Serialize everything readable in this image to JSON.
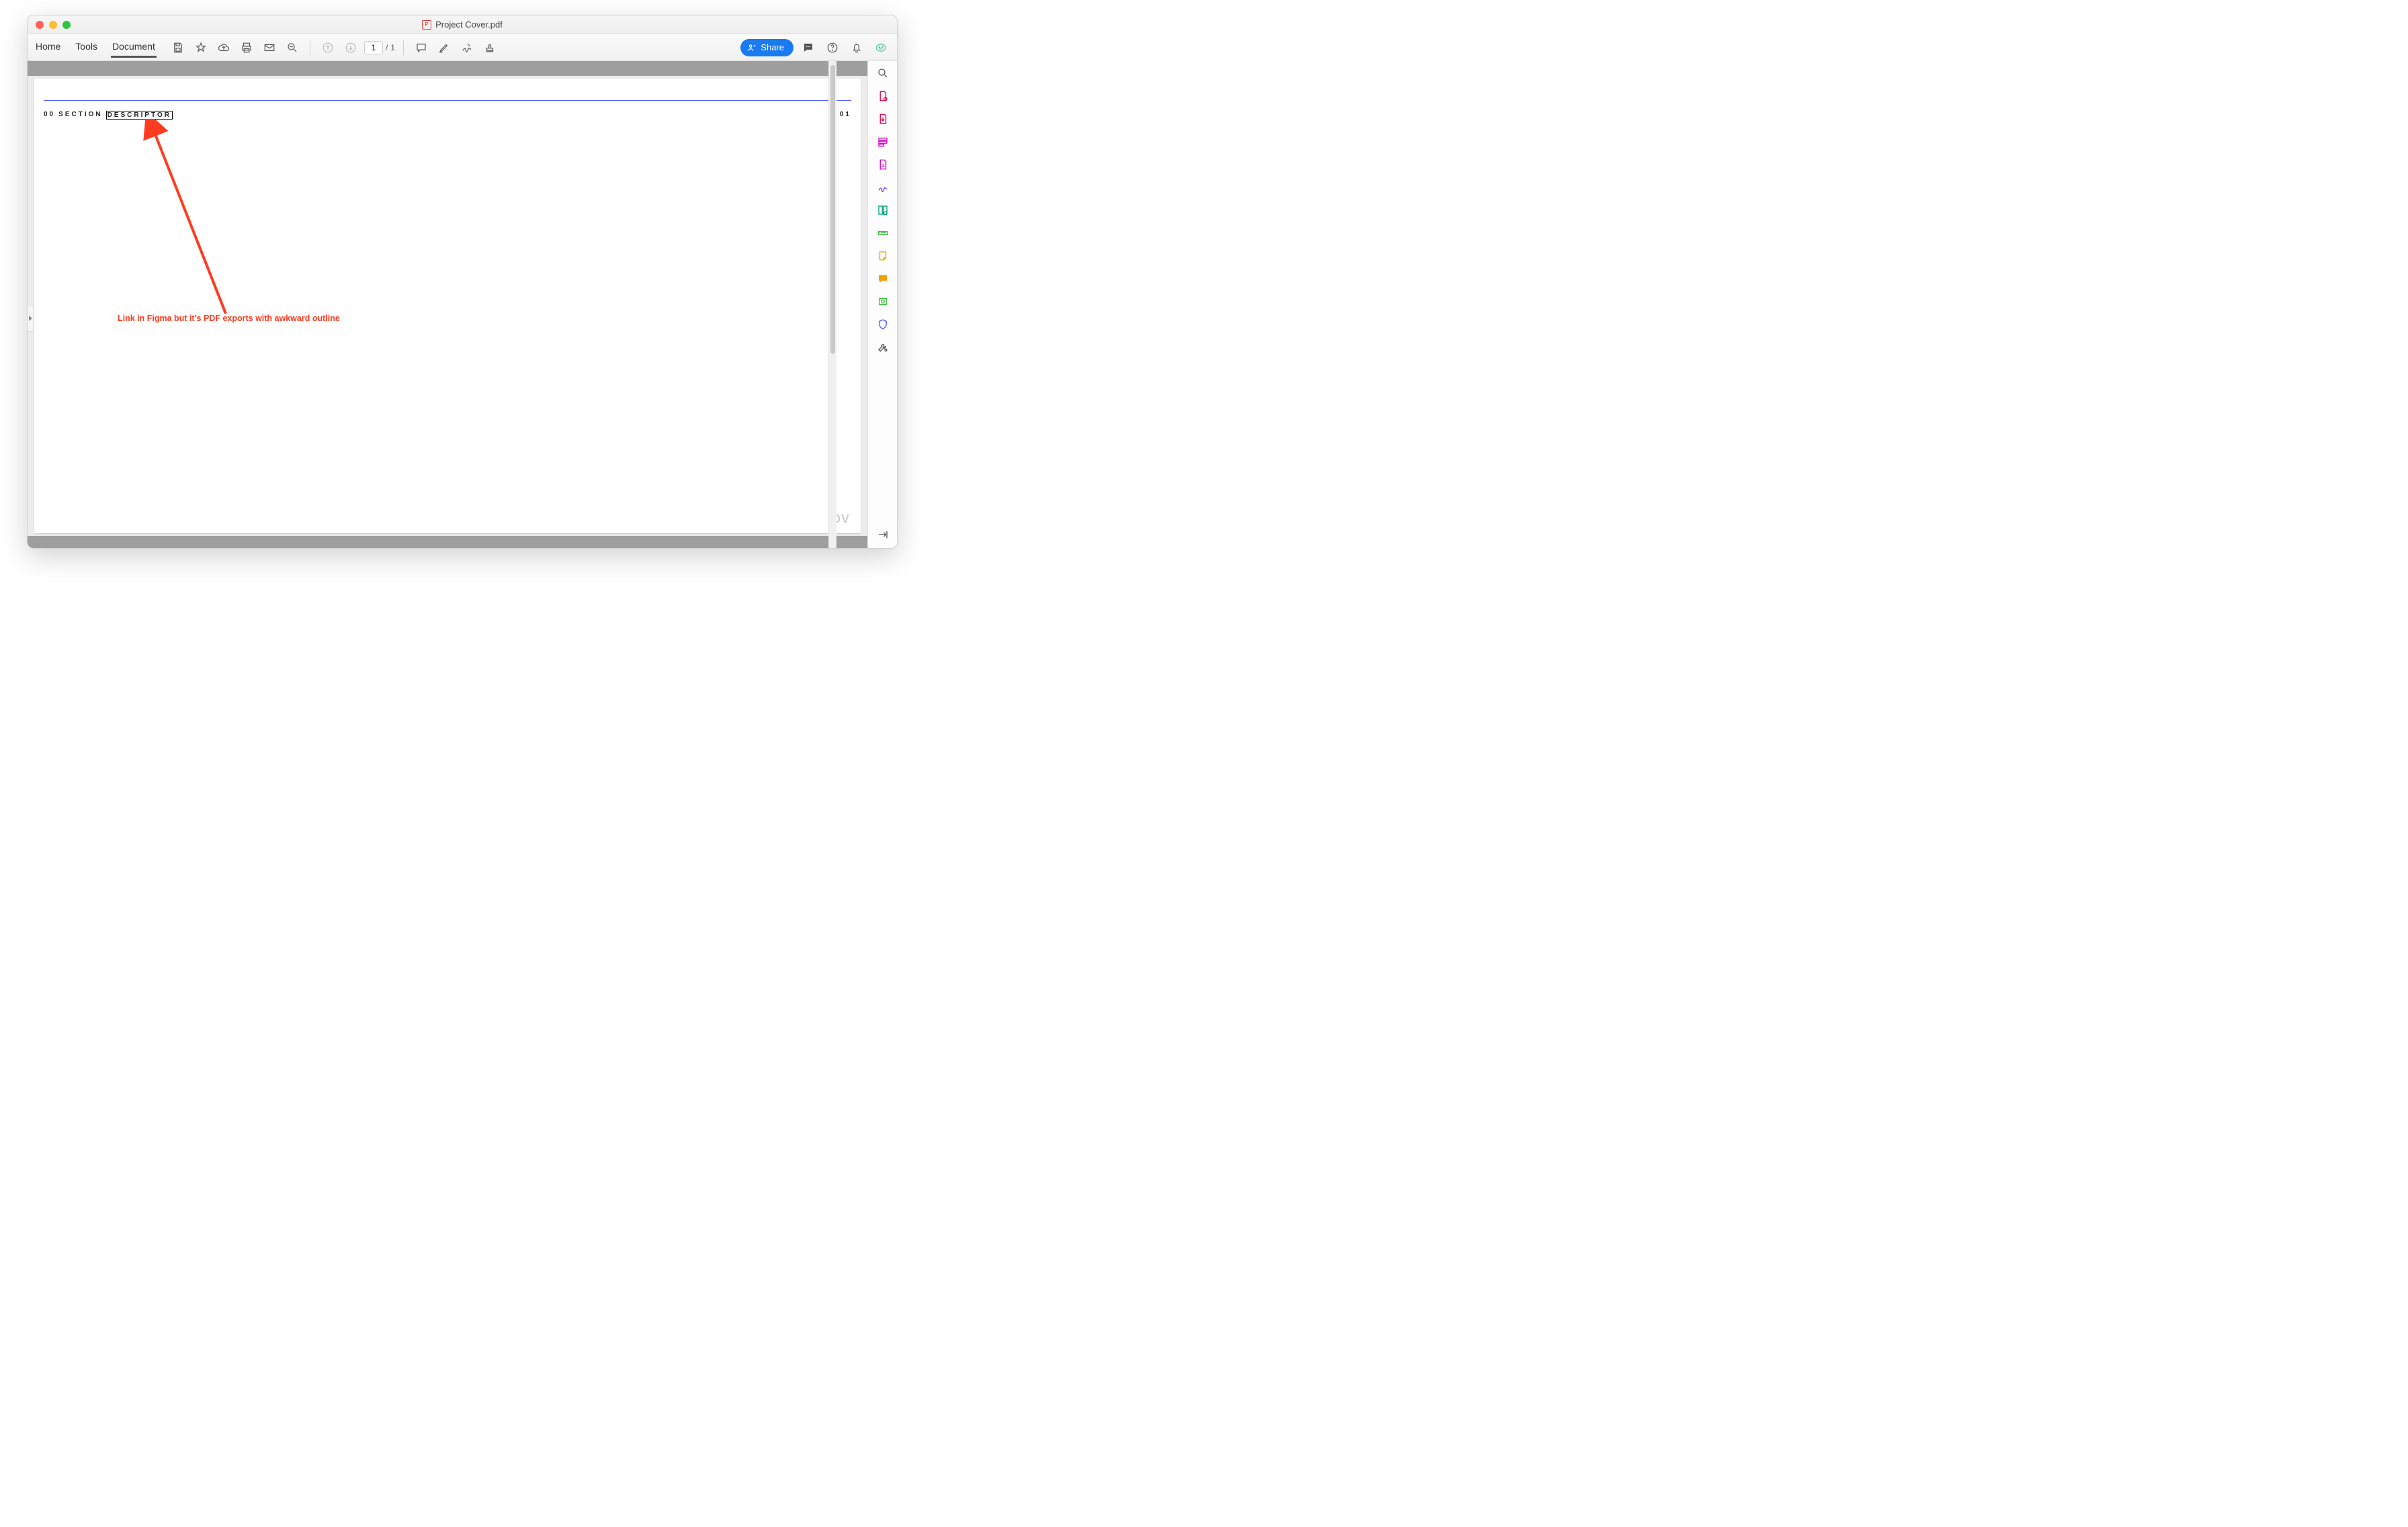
{
  "window": {
    "title": "Project Cover.pdf"
  },
  "menu": {
    "home": "Home",
    "tools": "Tools",
    "document": "Document"
  },
  "paging": {
    "current": "1",
    "sep": "/",
    "total": "1"
  },
  "share": {
    "label": "Share"
  },
  "page": {
    "section_num": "00",
    "section_word": "SECTION",
    "descriptor": "DESCRIPTOR",
    "page_num": "01",
    "watermark": "OV"
  },
  "annotation": {
    "text": "Link in Figma but it's PDF exports with awkward outline"
  },
  "rail_icons": [
    "search-icon",
    "create-pdf-icon",
    "export-pdf-icon",
    "organize-icon",
    "edit-pdf-icon",
    "sign-icon",
    "compare-icon",
    "measure-icon",
    "note-icon",
    "comment-icon",
    "print-prod-icon",
    "protect-icon",
    "more-tools-icon"
  ],
  "colors": {
    "accent": "#1a7af0",
    "annotation": "#ff3b20",
    "rule": "#4b5bff"
  }
}
